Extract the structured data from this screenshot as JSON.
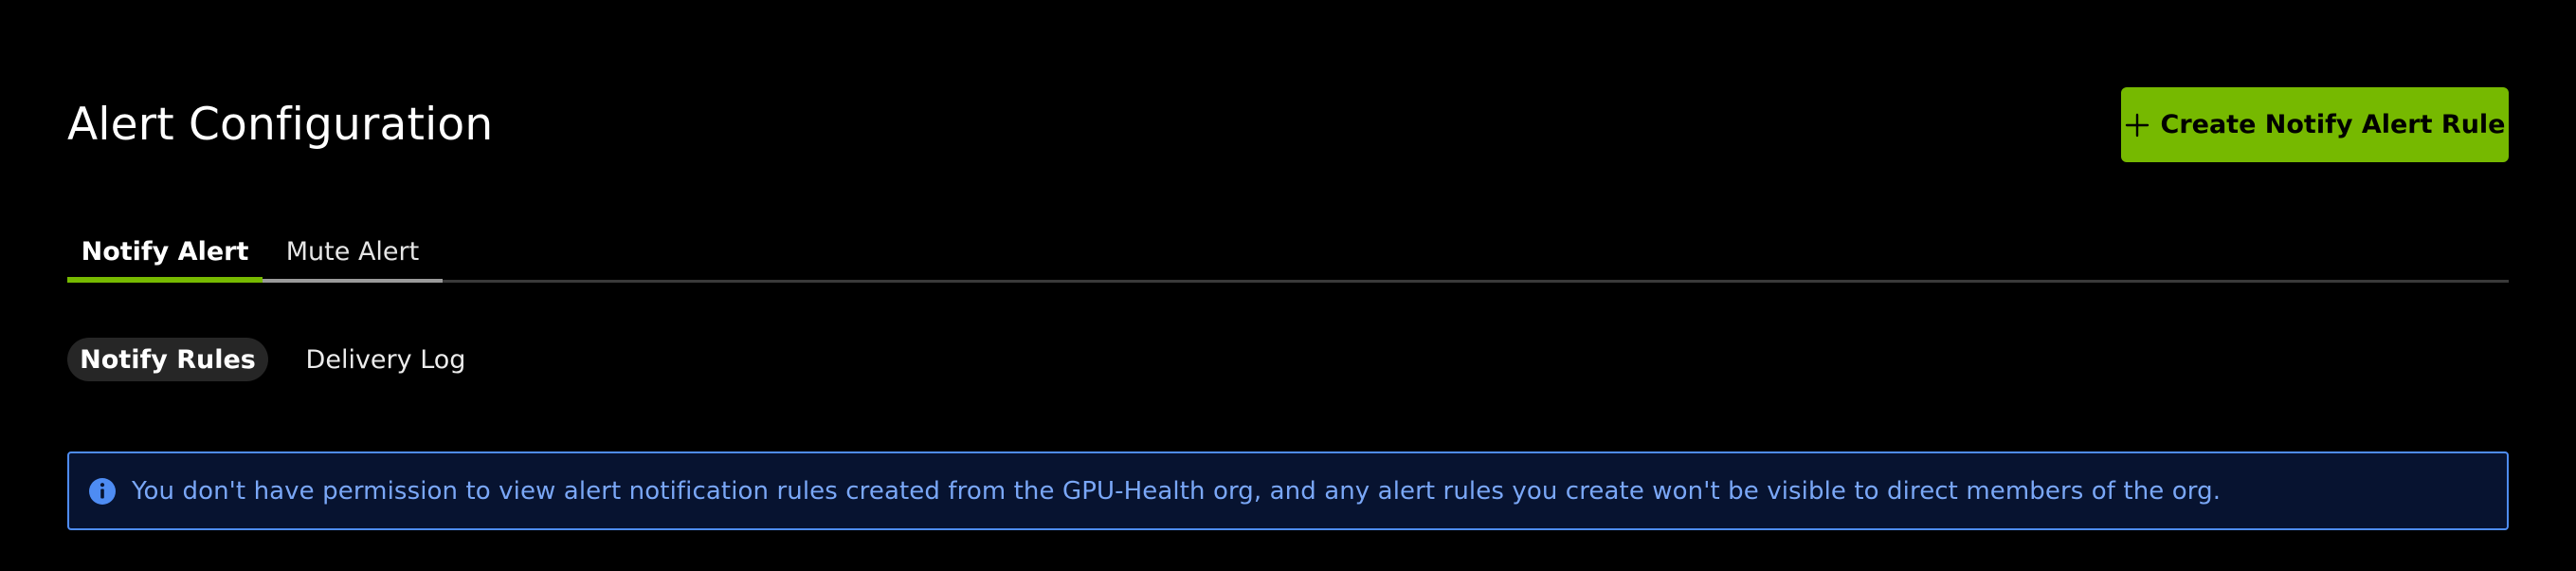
{
  "header": {
    "title": "Alert Configuration",
    "create_button_label": "Create Notify Alert Rule",
    "create_button_icon": "plus-icon"
  },
  "tabs": [
    {
      "label": "Notify Alert",
      "active": true
    },
    {
      "label": "Mute Alert",
      "active": false
    }
  ],
  "subtabs": [
    {
      "label": "Notify Rules",
      "active": true
    },
    {
      "label": "Delivery Log",
      "active": false
    }
  ],
  "info_banner": {
    "icon": "info-icon",
    "text": "You don't have permission to view alert notification rules created from the GPU-Health org, and any alert rules you create won't be visible to direct members of the org."
  },
  "colors": {
    "background": "#000000",
    "accent": "#76b900",
    "banner_border": "#4e8cf3",
    "banner_background": "#071330",
    "banner_text": "#7aa7f7"
  }
}
